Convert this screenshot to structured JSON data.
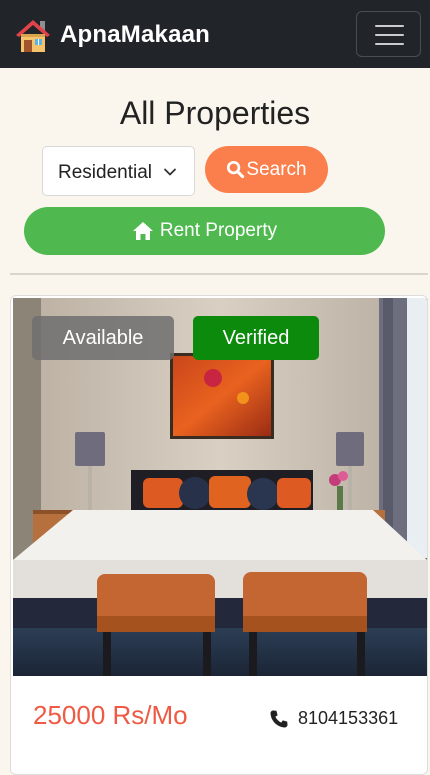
{
  "navbar": {
    "brand_name": "ApnaMakaan",
    "brand_icon": "house-emoji-icon",
    "menu_icon": "hamburger-menu-icon"
  },
  "page": {
    "title": "All Properties"
  },
  "filters": {
    "category_selected": "Residential",
    "search_label": "Search",
    "search_icon": "magnifier-icon",
    "rent_label": "Rent Property",
    "rent_icon": "home-icon"
  },
  "listing": {
    "status_badge": "Available",
    "verification_badge": "Verified",
    "price": "25000 Rs/Mo",
    "phone": "8104153361",
    "phone_icon": "phone-icon"
  },
  "colors": {
    "navbar": "#212529",
    "background": "#faf6ee",
    "search_button": "#fb7f4d",
    "rent_button": "#4fb84f",
    "verified_badge": "#0b8a0b",
    "price_text": "#ee5a43"
  }
}
